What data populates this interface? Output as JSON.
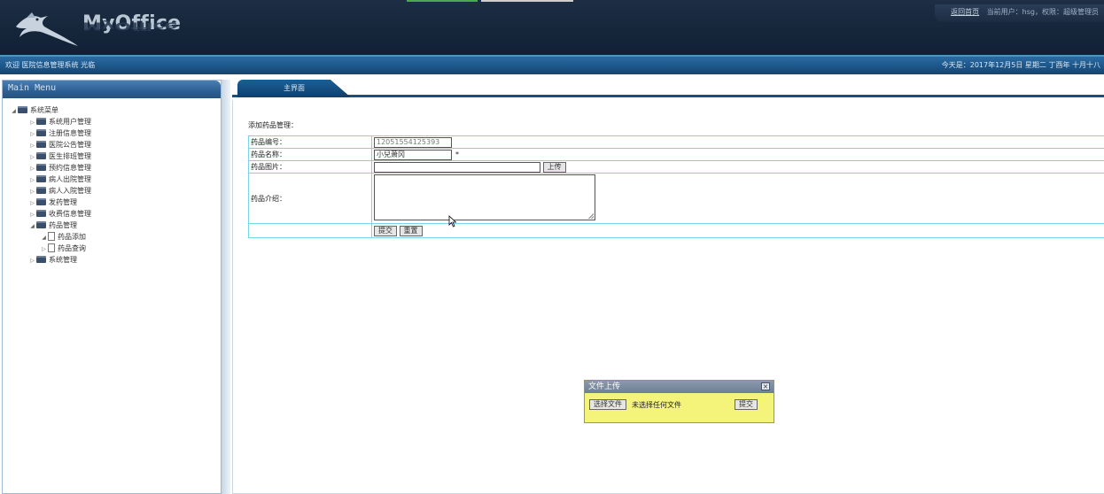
{
  "header": {
    "app_name": "MyOffice",
    "home_link": "返回首页",
    "user_info": "当前用户：hsg，权限：超级管理员"
  },
  "infobar": {
    "welcome": "欢迎 医院信息管理系统 光临",
    "today": "今天是：2017年12月5日 星期二 丁酉年 十月十八"
  },
  "sidebar": {
    "title": "Main Menu",
    "root": "系统菜单",
    "items": [
      {
        "label": "系统用户管理",
        "expanded": false
      },
      {
        "label": "注册信息管理",
        "expanded": false
      },
      {
        "label": "医院公告管理",
        "expanded": false
      },
      {
        "label": "医生排班管理",
        "expanded": false
      },
      {
        "label": "预约信息管理",
        "expanded": false
      },
      {
        "label": "病人出院管理",
        "expanded": false
      },
      {
        "label": "病人入院管理",
        "expanded": false
      },
      {
        "label": "发药管理",
        "expanded": false
      },
      {
        "label": "收费信息管理",
        "expanded": false
      },
      {
        "label": "药品管理",
        "expanded": true
      },
      {
        "label": "药品添加",
        "child": true
      },
      {
        "label": "药品查询",
        "child": true
      },
      {
        "label": "系统管理",
        "expanded": false
      }
    ]
  },
  "tabs": [
    {
      "label": "主界面",
      "active": true
    }
  ],
  "form": {
    "title": "添加药品管理：",
    "code_label": "药品编号：",
    "code_value": "12051554125393",
    "name_label": "药品名称：",
    "name_value": "小兒萧冈",
    "required_mark": "*",
    "image_label": "药品图片：",
    "upload_btn": "上传",
    "intro_label": "药品介绍：",
    "submit_btn": "提交",
    "reset_btn": "重置"
  },
  "upload_dialog": {
    "title": "文件上传",
    "close": "×",
    "choose_btn": "选择文件",
    "no_file": "未选择任何文件",
    "submit_btn": "提交"
  },
  "colors": {
    "header_bg": "#16263a",
    "infobar_bg": "#1f5a8e",
    "table_border": "#7ad4ea",
    "dialog_bg": "#f4f47a"
  }
}
